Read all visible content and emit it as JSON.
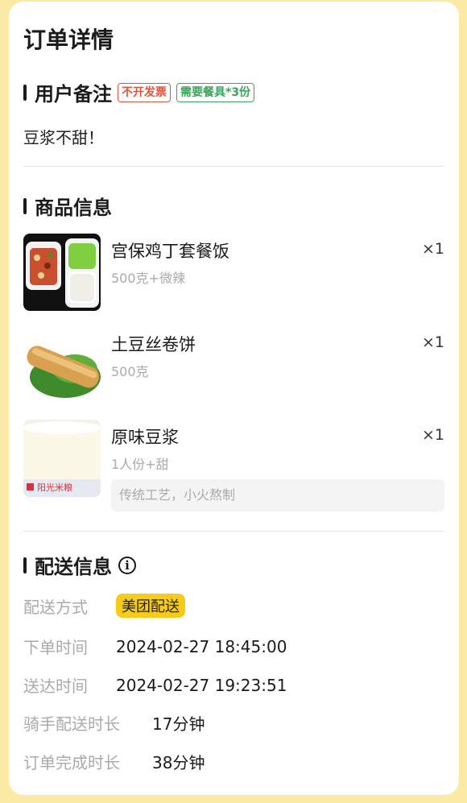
{
  "page": {
    "title": "订单详情"
  },
  "remark_section": {
    "title": "用户备注",
    "tags": [
      "不开发票",
      "需要餐具*3份"
    ],
    "text": "豆浆不甜！"
  },
  "goods_section": {
    "title": "商品信息",
    "items": [
      {
        "name": "宫保鸡丁套餐饭",
        "spec": "500克+微辣",
        "qty": "×1"
      },
      {
        "name": "土豆丝卷饼",
        "spec": "500克",
        "qty": "×1"
      },
      {
        "name": "原味豆浆",
        "spec": "1人份+甜",
        "qty": "×1",
        "note": "传统工艺，小火熬制",
        "brand": "阳光米粮"
      }
    ]
  },
  "delivery_section": {
    "title": "配送信息",
    "rows": [
      {
        "label": "配送方式",
        "value": "美团配送"
      },
      {
        "label": "下单时间",
        "value": "2024-02-27 18:45:00"
      },
      {
        "label": "送达时间",
        "value": "2024-02-27 19:23:51"
      },
      {
        "label": "骑手配送时长",
        "value": "17分钟"
      },
      {
        "label": "订单完成时长",
        "value": "38分钟"
      }
    ]
  },
  "colors": {
    "page_bg": "#fbeaa6",
    "badge": "#f6cc19",
    "tag_red": "#e2533b",
    "tag_green": "#3aa55c"
  }
}
